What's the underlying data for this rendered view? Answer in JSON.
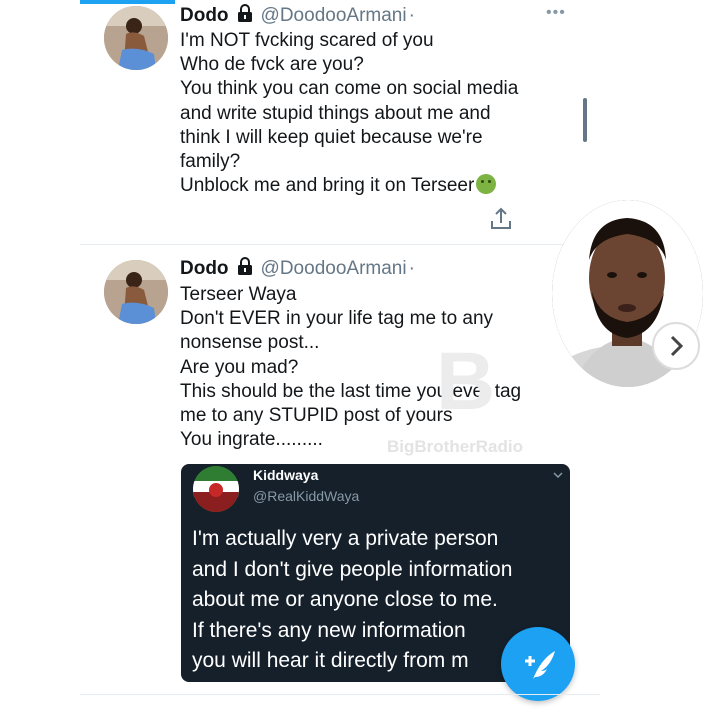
{
  "tweets": [
    {
      "name": "Dodo",
      "handle": "@DoodooArmani",
      "dot": "·",
      "more": "•••",
      "lines": [
        "I'm NOT fvcking scared of you",
        "Who de fvck are you?",
        "You think you can come on social media",
        "and write stupid things about me and",
        "think I will keep quiet because we're",
        "family?",
        "Unblock me and bring it on Terseer"
      ]
    },
    {
      "name": "Dodo",
      "handle": "@DoodooArmani",
      "dot": "·",
      "lines": [
        "Terseer Waya",
        "Don't EVER in your life tag me to any",
        "nonsense post...",
        "Are you mad?",
        "This should be the last time you ever tag",
        "me to any STUPID post of yours",
        "You ingrate........."
      ],
      "quoted": {
        "name": "Kiddwaya",
        "handle": "@RealKiddWaya",
        "lines": [
          "I'm actually very a private person",
          "and I don't give people information",
          "about me or anyone close to me.",
          "If there's any new information",
          "you will hear it directly from m"
        ]
      }
    }
  ],
  "watermark": {
    "letter": "B",
    "text": "BigBrotherRadio"
  },
  "icons": {
    "lock": "lock-icon",
    "share": "share-icon",
    "compose": "compose-tweet-icon",
    "next": "chevron-right-icon"
  },
  "colors": {
    "twitter_blue": "#1da1f2",
    "handle_gray": "#657786",
    "embed_bg": "#15202b",
    "emoji_green": "#7cb342"
  }
}
